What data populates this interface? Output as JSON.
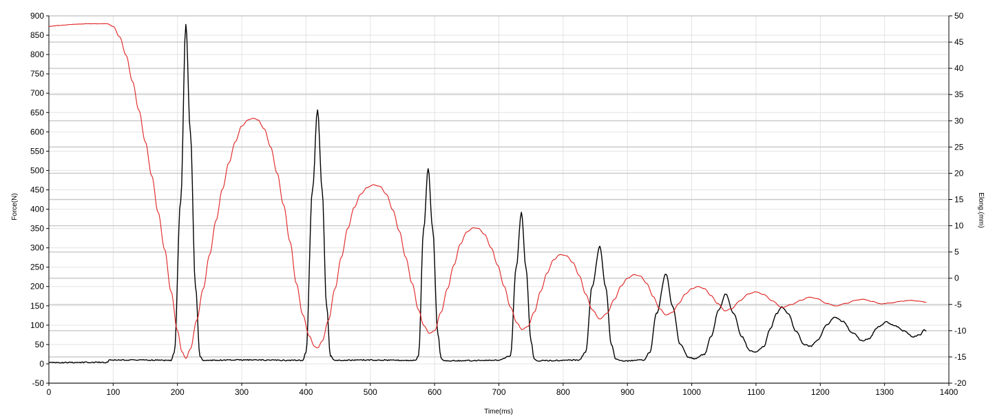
{
  "chart_data": {
    "type": "line",
    "xlabel": "Time(ms)",
    "ylabel_left": "Force(N)",
    "ylabel_right": "Elong.(mm)",
    "xlim": [
      0,
      1400
    ],
    "ylim_left": [
      -50,
      900
    ],
    "ylim_right": [
      -20,
      50
    ],
    "x_ticks": [
      "0",
      "100",
      "200",
      "300",
      "400",
      "500",
      "600",
      "700",
      "800",
      "900",
      "1000",
      "1100",
      "1200",
      "1300",
      "1400"
    ],
    "y_left_ticks": [
      "-50",
      "0",
      "50",
      "100",
      "150",
      "200",
      "250",
      "300",
      "350",
      "400",
      "450",
      "500",
      "550",
      "600",
      "650",
      "700",
      "750",
      "800",
      "850",
      "900"
    ],
    "y_right_ticks": [
      "-20",
      "-15",
      "-10",
      "-5",
      "0",
      "5",
      "10",
      "15",
      "20",
      "25",
      "30",
      "35",
      "40",
      "45",
      "50"
    ],
    "grid": true,
    "series": [
      {
        "axis": "left",
        "color": "#000000",
        "points": [
          [
            0,
            3
          ],
          [
            90,
            4
          ],
          [
            95,
            10
          ],
          [
            150,
            10
          ],
          [
            190,
            9
          ],
          [
            195,
            30
          ],
          [
            205,
            420
          ],
          [
            213,
            878
          ],
          [
            220,
            600
          ],
          [
            228,
            200
          ],
          [
            235,
            20
          ],
          [
            240,
            9
          ],
          [
            300,
            10
          ],
          [
            395,
            9
          ],
          [
            400,
            30
          ],
          [
            410,
            450
          ],
          [
            418,
            658
          ],
          [
            425,
            450
          ],
          [
            432,
            150
          ],
          [
            438,
            20
          ],
          [
            445,
            9
          ],
          [
            500,
            10
          ],
          [
            570,
            9
          ],
          [
            575,
            20
          ],
          [
            583,
            350
          ],
          [
            590,
            505
          ],
          [
            597,
            350
          ],
          [
            605,
            80
          ],
          [
            610,
            15
          ],
          [
            615,
            8
          ],
          [
            700,
            9
          ],
          [
            718,
            20
          ],
          [
            727,
            250
          ],
          [
            735,
            392
          ],
          [
            742,
            250
          ],
          [
            750,
            60
          ],
          [
            755,
            12
          ],
          [
            760,
            8
          ],
          [
            825,
            10
          ],
          [
            835,
            30
          ],
          [
            845,
            200
          ],
          [
            857,
            303
          ],
          [
            866,
            200
          ],
          [
            875,
            50
          ],
          [
            882,
            12
          ],
          [
            890,
            7
          ],
          [
            925,
            10
          ],
          [
            935,
            30
          ],
          [
            945,
            130
          ],
          [
            960,
            233
          ],
          [
            970,
            150
          ],
          [
            982,
            50
          ],
          [
            995,
            17
          ],
          [
            1005,
            13
          ],
          [
            1020,
            25
          ],
          [
            1030,
            70
          ],
          [
            1042,
            140
          ],
          [
            1053,
            181
          ],
          [
            1065,
            130
          ],
          [
            1078,
            70
          ],
          [
            1090,
            35
          ],
          [
            1100,
            30
          ],
          [
            1112,
            45
          ],
          [
            1122,
            90
          ],
          [
            1132,
            130
          ],
          [
            1140,
            147
          ],
          [
            1150,
            130
          ],
          [
            1162,
            85
          ],
          [
            1175,
            50
          ],
          [
            1185,
            45
          ],
          [
            1195,
            60
          ],
          [
            1210,
            100
          ],
          [
            1222,
            120
          ],
          [
            1235,
            110
          ],
          [
            1250,
            80
          ],
          [
            1265,
            60
          ],
          [
            1275,
            65
          ],
          [
            1290,
            95
          ],
          [
            1303,
            108
          ],
          [
            1315,
            100
          ],
          [
            1330,
            85
          ],
          [
            1345,
            70
          ],
          [
            1355,
            75
          ],
          [
            1362,
            88
          ],
          [
            1365,
            85
          ]
        ]
      },
      {
        "axis": "right",
        "color": "#e02020",
        "points": [
          [
            0,
            48
          ],
          [
            20,
            48.2
          ],
          [
            40,
            48.4
          ],
          [
            60,
            48.5
          ],
          [
            90,
            48.5
          ],
          [
            100,
            48
          ],
          [
            110,
            46
          ],
          [
            120,
            42.5
          ],
          [
            130,
            37.5
          ],
          [
            140,
            32
          ],
          [
            150,
            26
          ],
          [
            160,
            19.5
          ],
          [
            170,
            12.5
          ],
          [
            180,
            5.5
          ],
          [
            190,
            -2.5
          ],
          [
            200,
            -10
          ],
          [
            207,
            -14
          ],
          [
            213,
            -15.3
          ],
          [
            220,
            -13.5
          ],
          [
            230,
            -8
          ],
          [
            240,
            -2
          ],
          [
            250,
            4.5
          ],
          [
            260,
            11
          ],
          [
            270,
            17
          ],
          [
            280,
            22
          ],
          [
            290,
            26
          ],
          [
            300,
            29
          ],
          [
            310,
            30.2
          ],
          [
            318,
            30.5
          ],
          [
            325,
            30.2
          ],
          [
            335,
            28.5
          ],
          [
            345,
            25
          ],
          [
            355,
            20
          ],
          [
            365,
            14
          ],
          [
            375,
            7
          ],
          [
            385,
            -1
          ],
          [
            395,
            -7
          ],
          [
            405,
            -11
          ],
          [
            413,
            -13
          ],
          [
            418,
            -13.3
          ],
          [
            425,
            -12
          ],
          [
            435,
            -8
          ],
          [
            445,
            -2
          ],
          [
            455,
            4
          ],
          [
            465,
            9.5
          ],
          [
            475,
            13.5
          ],
          [
            485,
            16
          ],
          [
            495,
            17.3
          ],
          [
            505,
            17.8
          ],
          [
            515,
            17.5
          ],
          [
            525,
            16
          ],
          [
            535,
            13
          ],
          [
            545,
            9
          ],
          [
            555,
            4
          ],
          [
            565,
            -1
          ],
          [
            575,
            -6
          ],
          [
            583,
            -9
          ],
          [
            592,
            -10.5
          ],
          [
            600,
            -10
          ],
          [
            610,
            -6.5
          ],
          [
            620,
            -2
          ],
          [
            630,
            2.5
          ],
          [
            640,
            6.5
          ],
          [
            650,
            8.8
          ],
          [
            660,
            9.6
          ],
          [
            668,
            9.5
          ],
          [
            678,
            8.3
          ],
          [
            688,
            5.8
          ],
          [
            698,
            2.5
          ],
          [
            708,
            -1.5
          ],
          [
            718,
            -5.5
          ],
          [
            728,
            -8.5
          ],
          [
            736,
            -9.8
          ],
          [
            745,
            -9.2
          ],
          [
            755,
            -6.5
          ],
          [
            765,
            -2.5
          ],
          [
            775,
            1
          ],
          [
            785,
            3.5
          ],
          [
            795,
            4.5
          ],
          [
            805,
            4.3
          ],
          [
            815,
            3
          ],
          [
            825,
            0.5
          ],
          [
            835,
            -3
          ],
          [
            845,
            -6
          ],
          [
            857,
            -7.8
          ],
          [
            868,
            -6.7
          ],
          [
            880,
            -4
          ],
          [
            890,
            -1.5
          ],
          [
            900,
            0
          ],
          [
            910,
            0.7
          ],
          [
            920,
            0.4
          ],
          [
            930,
            -1
          ],
          [
            940,
            -3.5
          ],
          [
            950,
            -5.8
          ],
          [
            960,
            -7
          ],
          [
            970,
            -6.5
          ],
          [
            980,
            -4.8
          ],
          [
            990,
            -3
          ],
          [
            1000,
            -2
          ],
          [
            1010,
            -1.6
          ],
          [
            1020,
            -2
          ],
          [
            1030,
            -3.3
          ],
          [
            1040,
            -4.8
          ],
          [
            1052,
            -6.2
          ],
          [
            1062,
            -5.8
          ],
          [
            1075,
            -4.3
          ],
          [
            1088,
            -3
          ],
          [
            1100,
            -2.6
          ],
          [
            1112,
            -3.1
          ],
          [
            1125,
            -4.3
          ],
          [
            1140,
            -5.6
          ],
          [
            1155,
            -5
          ],
          [
            1170,
            -4.2
          ],
          [
            1183,
            -3.6
          ],
          [
            1195,
            -3.9
          ],
          [
            1210,
            -4.8
          ],
          [
            1225,
            -5.3
          ],
          [
            1240,
            -4.8
          ],
          [
            1255,
            -4.2
          ],
          [
            1267,
            -4
          ],
          [
            1280,
            -4.4
          ],
          [
            1295,
            -4.9
          ],
          [
            1310,
            -4.7
          ],
          [
            1325,
            -4.4
          ],
          [
            1340,
            -4.2
          ],
          [
            1355,
            -4.4
          ],
          [
            1365,
            -4.6
          ]
        ]
      }
    ]
  }
}
